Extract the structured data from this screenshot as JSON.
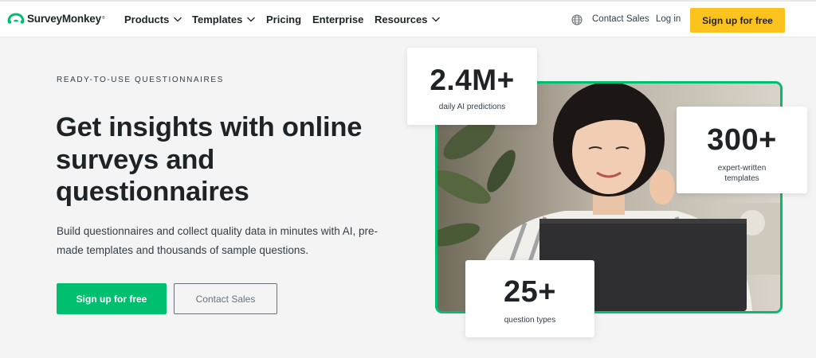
{
  "header": {
    "brand": "SurveyMonkey",
    "brand_mark": "®",
    "nav": {
      "products": "Products",
      "templates": "Templates",
      "pricing": "Pricing",
      "enterprise": "Enterprise",
      "resources": "Resources"
    },
    "contact_sales": "Contact Sales",
    "login": "Log in",
    "signup": "Sign up for free"
  },
  "hero": {
    "eyebrow": "READY-TO-USE QUESTIONNAIRES",
    "headline": "Get insights with online surveys and questionnaires",
    "subcopy": "Build questionnaires and collect quality data in minutes with AI, pre-made templates and thousands of sample questions.",
    "primary_cta": "Sign up for free",
    "secondary_cta": "Contact Sales"
  },
  "stats": [
    {
      "value": "2.4M+",
      "label": "daily AI predictions"
    },
    {
      "value": "300+",
      "label": "expert-written templates"
    },
    {
      "value": "25+",
      "label": "question types"
    }
  ],
  "colors": {
    "brand_green": "#00bf6f",
    "cta_yellow": "#fcc31f",
    "text_dark": "#1f2326",
    "background": "#f4f4f4"
  },
  "icons": {
    "logo": "surveymonkey-logo-icon",
    "chevron": "chevron-down-icon",
    "globe": "globe-icon"
  }
}
